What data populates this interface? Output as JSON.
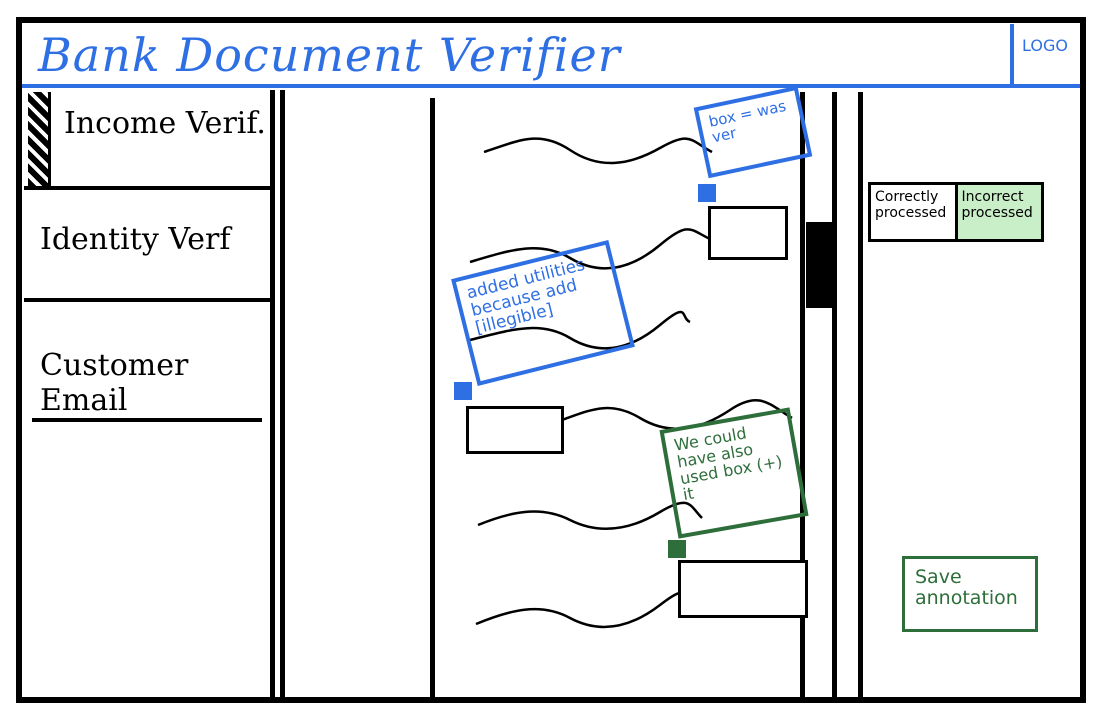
{
  "app": {
    "title": "Bank Document Verifier",
    "logo": "LOGO"
  },
  "sidebar": {
    "items": [
      {
        "label": "Income Verif.",
        "active": true
      },
      {
        "label": "Identity Verf",
        "active": false
      },
      {
        "label": "Customer Email",
        "active": false
      }
    ]
  },
  "annotations": [
    {
      "text": "box = was ver",
      "color": "#2f6fe4"
    },
    {
      "text": "added utilities because add [illegible]",
      "color": "#2f6fe4"
    },
    {
      "text": "We could have also used box (+) it",
      "color": "#2e6e3a"
    }
  ],
  "status_toggle": {
    "options": [
      "Correctly processed",
      "Incorrect processed"
    ],
    "selected": "Incorrect processed"
  },
  "actions": {
    "save_label": "Save annotation"
  },
  "colors": {
    "accent_blue": "#2f6fe4",
    "accent_green": "#2e6e3a",
    "toggle_highlight": "#c9efc8"
  }
}
